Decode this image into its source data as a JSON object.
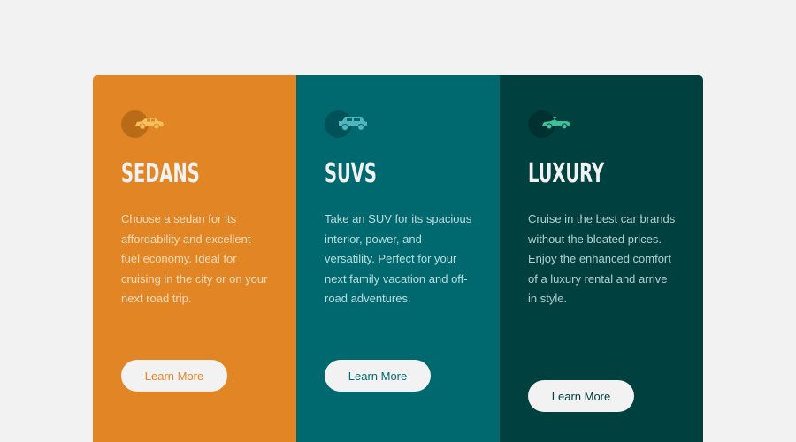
{
  "cards": [
    {
      "title": "SEDANS",
      "description": "Choose a sedan for its affordability and excellent fuel economy. Ideal for cruising in the city or on your next road trip.",
      "button_label": "Learn More",
      "icon": "sedan-icon",
      "color": "#e28625"
    },
    {
      "title": "SUVS",
      "description": "Take an SUV for its spacious interior, power, and versatility. Perfect for your next family vacation and off-road adventures.",
      "button_label": "Learn More",
      "icon": "suv-icon",
      "color": "#006970"
    },
    {
      "title": "LUXURY",
      "description": "Cruise in the best car brands without the bloated prices. Enjoy the enhanced comfort of a luxury rental and arrive in style.",
      "button_label": "Learn More",
      "icon": "luxury-car-icon",
      "color": "#004140"
    }
  ],
  "colors": {
    "background": "#f2f2f2",
    "sedans_icon": "#f7c25e",
    "suvs_icon": "#51b5bb",
    "luxury_icon": "#3fbf9c"
  }
}
